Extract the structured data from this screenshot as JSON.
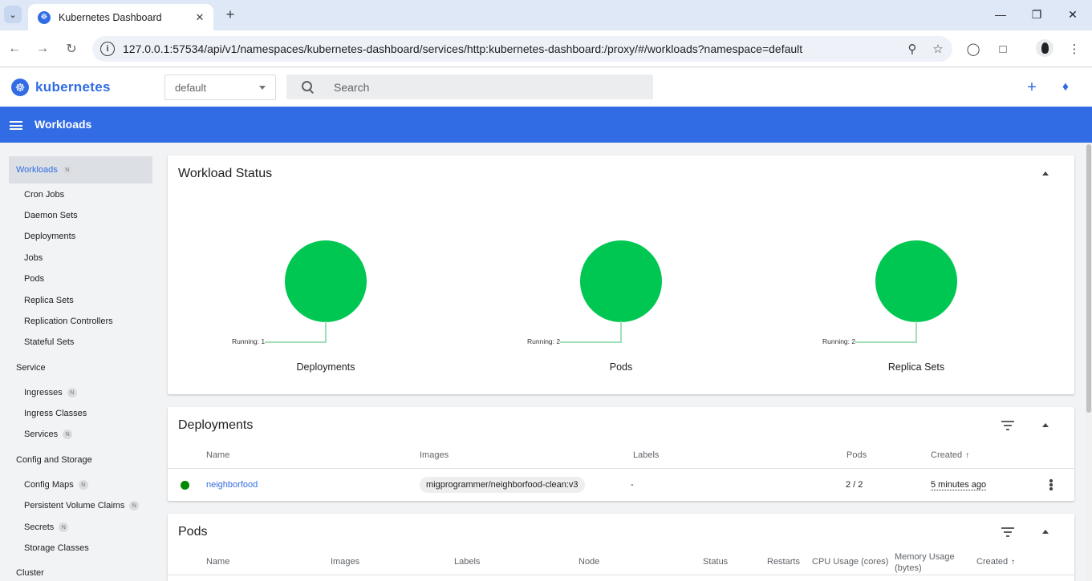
{
  "browser": {
    "tab_title": "Kubernetes Dashboard",
    "url": "127.0.0.1:57534/api/v1/namespaces/kubernetes-dashboard/services/http:kubernetes-dashboard:/proxy/#/workloads?namespace=default"
  },
  "header": {
    "brand": "kubernetes",
    "namespace": "default",
    "search_placeholder": "Search"
  },
  "appbar": {
    "title": "Workloads"
  },
  "sidebar": {
    "active": {
      "label": "Workloads",
      "badge": "N"
    },
    "workload_items": [
      "Cron Jobs",
      "Daemon Sets",
      "Deployments",
      "Jobs",
      "Pods",
      "Replica Sets",
      "Replication Controllers",
      "Stateful Sets"
    ],
    "service_section": "Service",
    "service_items": [
      {
        "label": "Ingresses",
        "badge": "N"
      },
      {
        "label": "Ingress Classes",
        "badge": ""
      },
      {
        "label": "Services",
        "badge": "N"
      }
    ],
    "config_section": "Config and Storage",
    "config_items": [
      {
        "label": "Config Maps",
        "badge": "N"
      },
      {
        "label": "Persistent Volume Claims",
        "badge": "N"
      },
      {
        "label": "Secrets",
        "badge": "N"
      },
      {
        "label": "Storage Classes",
        "badge": ""
      }
    ],
    "cluster_section": "Cluster"
  },
  "workload_status": {
    "title": "Workload Status",
    "charts": [
      {
        "name": "Deployments",
        "running_label": "Running: 1",
        "running": 1
      },
      {
        "name": "Pods",
        "running_label": "Running: 2",
        "running": 2
      },
      {
        "name": "Replica Sets",
        "running_label": "Running: 2",
        "running": 2
      }
    ]
  },
  "deployments": {
    "title": "Deployments",
    "columns": [
      "Name",
      "Images",
      "Labels",
      "Pods",
      "Created"
    ],
    "rows": [
      {
        "name": "neighborfood",
        "image": "migprogrammer/neighborfood-clean:v3",
        "labels": "-",
        "pods": "2 / 2",
        "created": "5 minutes ago",
        "status_color": "#008a00"
      }
    ]
  },
  "pods": {
    "title": "Pods",
    "columns": [
      "Name",
      "Images",
      "Labels",
      "Node",
      "Status",
      "Restarts",
      "CPU Usage (cores)",
      "Memory Usage",
      "(bytes)",
      "Created"
    ]
  },
  "colors": {
    "accent": "#326ce5",
    "running": "#00c752",
    "status_ok": "#008a00"
  }
}
